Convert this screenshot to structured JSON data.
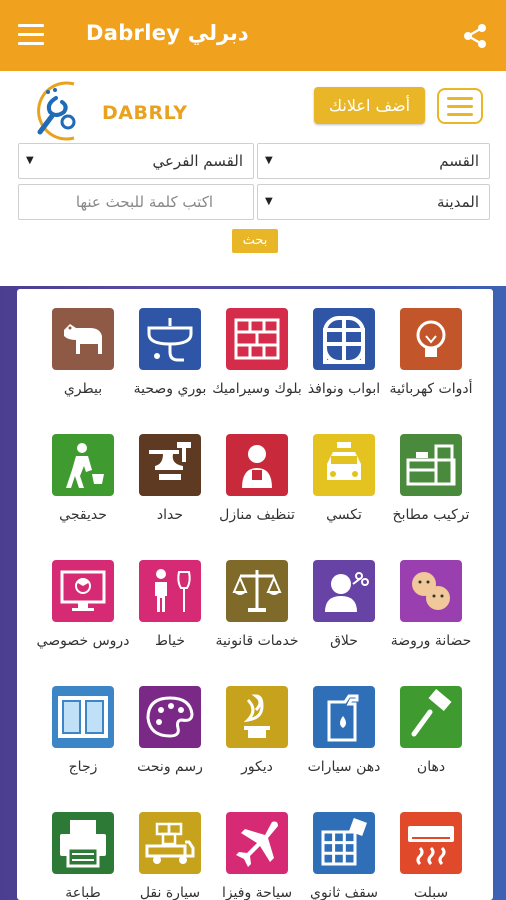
{
  "appbar": {
    "title": "Dabrley دبرلي"
  },
  "logo": {
    "text": "DABRLY"
  },
  "header": {
    "ad_button": "أضف اعلانك"
  },
  "filters": {
    "section": "القسم",
    "subsection": "القسم الفرعي",
    "city": "المدينة",
    "search_placeholder": "اكتب كلمة للبحث عنها",
    "search_button": "بحث"
  },
  "categories": [
    {
      "label": "أدوات كهربائية",
      "icon": "lightbulb-icon",
      "color": "#c3552a"
    },
    {
      "label": "ابواب ونوافذ",
      "icon": "window-icon",
      "color": "#2f56a6"
    },
    {
      "label": "بلوك وسيراميك",
      "icon": "brick-wall-icon",
      "color": "#d52c4b"
    },
    {
      "label": "بوري وصحية",
      "icon": "sink-icon",
      "color": "#2f56a6"
    },
    {
      "label": "بيطري",
      "icon": "dog-icon",
      "color": "#8e5a45"
    },
    {
      "label": "تركيب مطابخ",
      "icon": "kitchen-icon",
      "color": "#4a8a3c"
    },
    {
      "label": "تكسي",
      "icon": "taxi-icon",
      "color": "#e4c21f"
    },
    {
      "label": "تنظيف منازل",
      "icon": "cleaner-icon",
      "color": "#c82a3c"
    },
    {
      "label": "حداد",
      "icon": "anvil-icon",
      "color": "#5e3a22"
    },
    {
      "label": "حديقجي",
      "icon": "gardener-icon",
      "color": "#3f9b2f"
    },
    {
      "label": "حضانة وروضة",
      "icon": "children-icon",
      "color": "#9a3fb0"
    },
    {
      "label": "حلاق",
      "icon": "barber-icon",
      "color": "#6843a6"
    },
    {
      "label": "خدمات قانونية",
      "icon": "scales-icon",
      "color": "#7f6a2a"
    },
    {
      "label": "خياط",
      "icon": "tailor-icon",
      "color": "#d62a74"
    },
    {
      "label": "دروس خصوصي",
      "icon": "online-lesson-icon",
      "color": "#d62a74"
    },
    {
      "label": "دهان",
      "icon": "paint-roller-icon",
      "color": "#3f9b2f"
    },
    {
      "label": "دهن سيارات",
      "icon": "paint-can-icon",
      "color": "#2f6fb8"
    },
    {
      "label": "ديكور",
      "icon": "decor-icon",
      "color": "#c7a21c"
    },
    {
      "label": "رسم ونحت",
      "icon": "palette-icon",
      "color": "#7a2a86"
    },
    {
      "label": "زجاج",
      "icon": "glass-window-icon",
      "color": "#3c86c8"
    },
    {
      "label": "سبلت",
      "icon": "air-conditioner-icon",
      "color": "#e04a2a"
    },
    {
      "label": "سقف ثانوي",
      "icon": "ceiling-icon",
      "color": "#2f6fb8"
    },
    {
      "label": "سياحة وفيزا",
      "icon": "airplane-icon",
      "color": "#d62a74"
    },
    {
      "label": "سيارة نقل",
      "icon": "truck-icon",
      "color": "#c7a21c"
    },
    {
      "label": "طباعة",
      "icon": "printer-icon",
      "color": "#2c7a35"
    }
  ]
}
